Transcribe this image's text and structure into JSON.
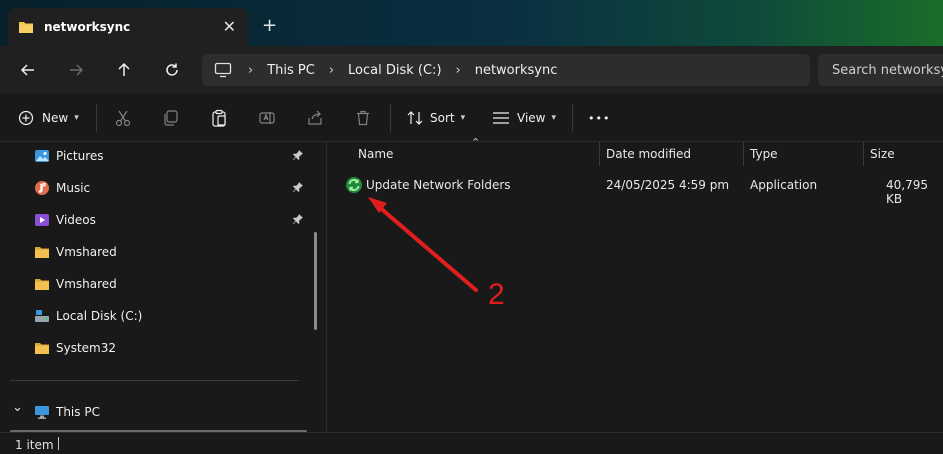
{
  "window": {
    "tab_title": "networksync",
    "tab_close": "✕",
    "new_tab": "+"
  },
  "navigation": {
    "breadcrumbs": [
      "This PC",
      "Local Disk (C:)",
      "networksync"
    ],
    "separator": "›",
    "search_placeholder": "Search networksync"
  },
  "toolbar": {
    "new_label": "New",
    "sort_label": "Sort",
    "view_label": "View",
    "more": "•••"
  },
  "sidebar": {
    "items": [
      {
        "label": "Pictures",
        "icon": "pictures-icon",
        "pinned": true
      },
      {
        "label": "Music",
        "icon": "music-icon",
        "pinned": true
      },
      {
        "label": "Videos",
        "icon": "videos-icon",
        "pinned": true
      },
      {
        "label": "Vmshared",
        "icon": "folder-icon",
        "pinned": false
      },
      {
        "label": "Vmshared",
        "icon": "folder-icon",
        "pinned": false
      },
      {
        "label": "Local Disk (C:)",
        "icon": "drive-icon",
        "pinned": false
      },
      {
        "label": "System32",
        "icon": "folder-icon",
        "pinned": false
      }
    ],
    "this_pc": "This PC",
    "expand_glyph": "⌄"
  },
  "file_list": {
    "columns": [
      "Name",
      "Date modified",
      "Type",
      "Size"
    ],
    "sort_glyph": "⌃",
    "rows": [
      {
        "name": "Update Network Folders",
        "date_modified": "24/05/2025 4:59 pm",
        "type": "Application",
        "size": "40,795 KB",
        "icon": "sync-app-icon"
      }
    ]
  },
  "status": {
    "item_count": "1 item"
  },
  "annotation": {
    "label": "2",
    "color": "#e01e1e"
  },
  "colors": {
    "folder": "#f2c14e",
    "accent": "#3a96dd"
  }
}
